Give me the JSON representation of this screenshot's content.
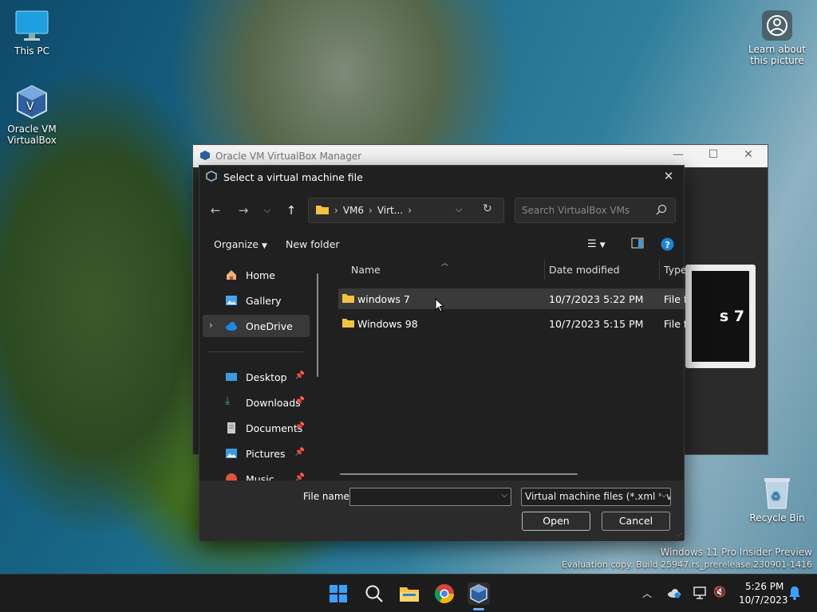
{
  "desktop": {
    "icons": [
      {
        "label": "This PC"
      },
      {
        "label": "Oracle VM VirtualBox"
      },
      {
        "label": "Recycle Bin"
      }
    ],
    "learn_label": "Learn about this picture",
    "watermark_line1": "Windows 11 Pro Insider Preview",
    "watermark_line2": "Evaluation copy. Build 25947.rs_prerelease.230901-1416"
  },
  "vbox_window": {
    "title": "Oracle VM VirtualBox Manager",
    "preview_text": "s 7"
  },
  "dialog": {
    "title": "Select a virtual machine file",
    "breadcrumb": [
      "VM6",
      "Virt..."
    ],
    "search_placeholder": "Search VirtualBox VMs",
    "organize_label": "Organize",
    "new_folder_label": "New folder",
    "sidebar": [
      {
        "label": "Home",
        "icon": "home-icon"
      },
      {
        "label": "Gallery",
        "icon": "gallery-icon"
      },
      {
        "label": "OneDrive",
        "icon": "cloud-icon"
      },
      {
        "label": "Desktop",
        "icon": "desktop-icon"
      },
      {
        "label": "Downloads",
        "icon": "download-icon"
      },
      {
        "label": "Documents",
        "icon": "document-icon"
      },
      {
        "label": "Pictures",
        "icon": "picture-icon"
      },
      {
        "label": "Music",
        "icon": "music-icon"
      }
    ],
    "columns": {
      "name": "Name",
      "date": "Date modified",
      "type": "Type"
    },
    "files": [
      {
        "name": "windows 7",
        "date": "10/7/2023 5:22 PM",
        "type": "File fo"
      },
      {
        "name": "Windows 98",
        "date": "10/7/2023 5:15 PM",
        "type": "File fo"
      }
    ],
    "file_name_label": "File name:",
    "file_name_value": "",
    "filter_value": "Virtual machine files (*.xml *.vb",
    "open_label": "Open",
    "cancel_label": "Cancel"
  },
  "taskbar": {
    "time": "5:26 PM",
    "date": "10/7/2023"
  },
  "colors": {
    "accent": "#0078d4",
    "folder": "#f3c240",
    "dialog_bg": "#202020"
  }
}
